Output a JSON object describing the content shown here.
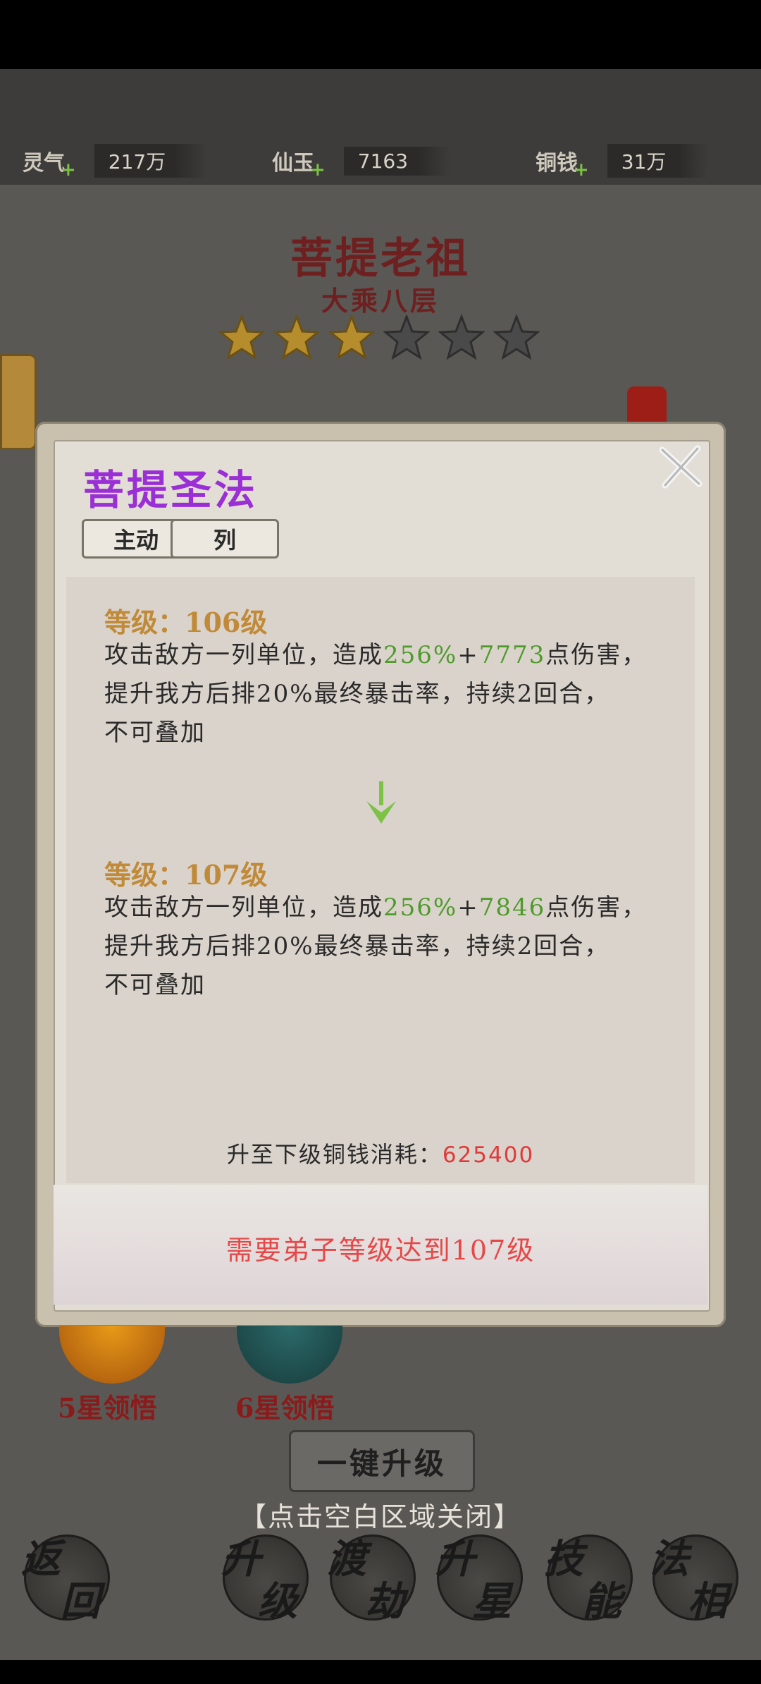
{
  "resources": [
    {
      "name": "灵气",
      "value": "217万"
    },
    {
      "name": "仙玉",
      "value": "7163"
    },
    {
      "name": "铜钱",
      "value": "31万"
    }
  ],
  "hero": {
    "name": "菩提老祖",
    "rank": "大乘八层",
    "stars_filled": 3,
    "stars_total": 6
  },
  "popup": {
    "skill_name": "菩提圣法",
    "tags": [
      "主动",
      "列"
    ],
    "current": {
      "level_label": "等级：106级",
      "line1_pre": "攻击敌方一列单位，造成",
      "percent": "256%",
      "plus": "+",
      "flat": "7773",
      "line1_post": "点伤害，",
      "line2": "提升我方后排20%最终暴击率，持续2回合，",
      "line3": "不可叠加"
    },
    "next": {
      "level_label": "等级：107级",
      "line1_pre": "攻击敌方一列单位，造成",
      "percent": "256%",
      "plus": "+",
      "flat": "7846",
      "line1_post": "点伤害，",
      "line2": "提升我方后排20%最终暴击率，持续2回合，",
      "line3": "不可叠加"
    },
    "cost_label": "升至下级铜钱消耗：",
    "cost_value": "625400",
    "requirement": "需要弟子等级达到107级"
  },
  "under": {
    "labels": [
      "5星领悟",
      "6星领悟"
    ],
    "one_key_upgrade": "一键升级",
    "close_hint": "【点击空白区域关闭】"
  },
  "nav": [
    {
      "t1": "返",
      "t2": "回"
    },
    {
      "t1": "升",
      "t2": "级"
    },
    {
      "t1": "渡",
      "t2": "劫"
    },
    {
      "t1": "升",
      "t2": "星"
    },
    {
      "t1": "技",
      "t2": "能"
    },
    {
      "t1": "法",
      "t2": "相"
    }
  ],
  "colors": {
    "skill_title": "#9b2fd6",
    "level": "#c08a38",
    "highlight": "#4e9a2b",
    "warning": "#e64848"
  }
}
